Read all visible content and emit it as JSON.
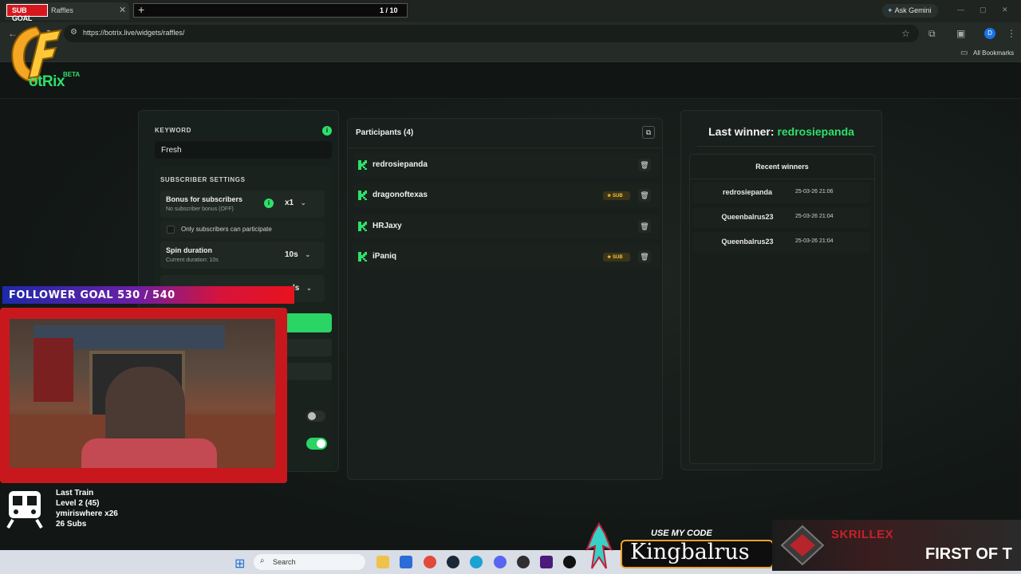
{
  "browser": {
    "tab_title": "Raffles",
    "sub_goal": "SUB GOAL",
    "goal_count": "1 / 10",
    "url": "https://botrix.live/widgets/raffles/",
    "gemini": "Ask Gemini",
    "all_bookmarks": "All Bookmarks",
    "profile_initial": "D"
  },
  "site": {
    "logo_text": "otRix",
    "beta": "BETA"
  },
  "settings": {
    "keyword_label": "KEYWORD",
    "keyword_value": "Fresh",
    "subscriber_heading": "SUBSCRIBER SETTINGS",
    "bonus_title": "Bonus for subscribers",
    "bonus_sub": "No subscriber bonus (OFF)",
    "bonus_select": "x1",
    "only_subs": "Only subscribers can participate",
    "spin_title": "Spin duration",
    "spin_sub": "Current duration: 10s",
    "spin_select": "10s",
    "hidden_select_tail": "ls"
  },
  "participants": {
    "title": "Participants (4)",
    "items": [
      {
        "name": "redrosiepanda",
        "sub": ""
      },
      {
        "name": "dragonoftexas",
        "sub": "SUB"
      },
      {
        "name": "HRJaxy",
        "sub": ""
      },
      {
        "name": "iPaniq",
        "sub": "SUB"
      }
    ]
  },
  "winners": {
    "last_label": "Last winner:",
    "last_name": "redrosiepanda",
    "recent_title": "Recent winners",
    "items": [
      {
        "name": "redrosiepanda",
        "date": "25-03-26 21:06"
      },
      {
        "name": "Queenbalrus23",
        "date": "25-03-26 21:04"
      },
      {
        "name": "Queenbalrus23",
        "date": "25-03-26 21:04"
      }
    ]
  },
  "overlay": {
    "follower_goal": "FOLLOWER GOAL 530 / 540",
    "stats": [
      "Last Train",
      "Level 2  (45)",
      "ymiriswhere x26",
      "26 Subs"
    ],
    "code_small": "USE MY CODE",
    "code_big": "Kingbalrus",
    "skrillex": "SKRILLEX",
    "first_of": "FIRST OF T"
  },
  "taskbar": {
    "search": "Search"
  },
  "colors": {
    "accent": "#2ee06a",
    "background": "#141a17",
    "sub_badge": "#f1c43a"
  }
}
